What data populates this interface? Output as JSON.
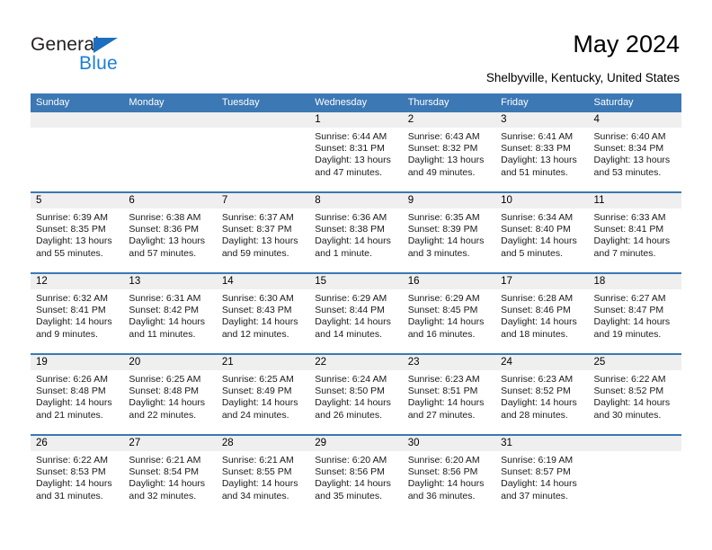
{
  "brand": {
    "name_top": "General",
    "name_bottom": "Blue",
    "triangle_color": "#1c6fc0",
    "blue_color": "#1c7fd6"
  },
  "header": {
    "title": "May 2024",
    "subtitle": "Shelbyville, Kentucky, United States"
  },
  "theme": {
    "header_row_bg": "#3c78b4",
    "day_number_bg": "#efefef",
    "text_color": "#000000"
  },
  "weekdays": [
    "Sunday",
    "Monday",
    "Tuesday",
    "Wednesday",
    "Thursday",
    "Friday",
    "Saturday"
  ],
  "labels": {
    "sunrise": "Sunrise:",
    "sunset": "Sunset:",
    "daylight": "Daylight:"
  },
  "weeks": [
    [
      {
        "day": "",
        "empty": true
      },
      {
        "day": "",
        "empty": true
      },
      {
        "day": "",
        "empty": true
      },
      {
        "day": "1",
        "sunrise": "Sunrise: 6:44 AM",
        "sunset": "Sunset: 8:31 PM",
        "daylight1": "Daylight: 13 hours",
        "daylight2": "and 47 minutes."
      },
      {
        "day": "2",
        "sunrise": "Sunrise: 6:43 AM",
        "sunset": "Sunset: 8:32 PM",
        "daylight1": "Daylight: 13 hours",
        "daylight2": "and 49 minutes."
      },
      {
        "day": "3",
        "sunrise": "Sunrise: 6:41 AM",
        "sunset": "Sunset: 8:33 PM",
        "daylight1": "Daylight: 13 hours",
        "daylight2": "and 51 minutes."
      },
      {
        "day": "4",
        "sunrise": "Sunrise: 6:40 AM",
        "sunset": "Sunset: 8:34 PM",
        "daylight1": "Daylight: 13 hours",
        "daylight2": "and 53 minutes."
      }
    ],
    [
      {
        "day": "5",
        "sunrise": "Sunrise: 6:39 AM",
        "sunset": "Sunset: 8:35 PM",
        "daylight1": "Daylight: 13 hours",
        "daylight2": "and 55 minutes."
      },
      {
        "day": "6",
        "sunrise": "Sunrise: 6:38 AM",
        "sunset": "Sunset: 8:36 PM",
        "daylight1": "Daylight: 13 hours",
        "daylight2": "and 57 minutes."
      },
      {
        "day": "7",
        "sunrise": "Sunrise: 6:37 AM",
        "sunset": "Sunset: 8:37 PM",
        "daylight1": "Daylight: 13 hours",
        "daylight2": "and 59 minutes."
      },
      {
        "day": "8",
        "sunrise": "Sunrise: 6:36 AM",
        "sunset": "Sunset: 8:38 PM",
        "daylight1": "Daylight: 14 hours",
        "daylight2": "and 1 minute."
      },
      {
        "day": "9",
        "sunrise": "Sunrise: 6:35 AM",
        "sunset": "Sunset: 8:39 PM",
        "daylight1": "Daylight: 14 hours",
        "daylight2": "and 3 minutes."
      },
      {
        "day": "10",
        "sunrise": "Sunrise: 6:34 AM",
        "sunset": "Sunset: 8:40 PM",
        "daylight1": "Daylight: 14 hours",
        "daylight2": "and 5 minutes."
      },
      {
        "day": "11",
        "sunrise": "Sunrise: 6:33 AM",
        "sunset": "Sunset: 8:41 PM",
        "daylight1": "Daylight: 14 hours",
        "daylight2": "and 7 minutes."
      }
    ],
    [
      {
        "day": "12",
        "sunrise": "Sunrise: 6:32 AM",
        "sunset": "Sunset: 8:41 PM",
        "daylight1": "Daylight: 14 hours",
        "daylight2": "and 9 minutes."
      },
      {
        "day": "13",
        "sunrise": "Sunrise: 6:31 AM",
        "sunset": "Sunset: 8:42 PM",
        "daylight1": "Daylight: 14 hours",
        "daylight2": "and 11 minutes."
      },
      {
        "day": "14",
        "sunrise": "Sunrise: 6:30 AM",
        "sunset": "Sunset: 8:43 PM",
        "daylight1": "Daylight: 14 hours",
        "daylight2": "and 12 minutes."
      },
      {
        "day": "15",
        "sunrise": "Sunrise: 6:29 AM",
        "sunset": "Sunset: 8:44 PM",
        "daylight1": "Daylight: 14 hours",
        "daylight2": "and 14 minutes."
      },
      {
        "day": "16",
        "sunrise": "Sunrise: 6:29 AM",
        "sunset": "Sunset: 8:45 PM",
        "daylight1": "Daylight: 14 hours",
        "daylight2": "and 16 minutes."
      },
      {
        "day": "17",
        "sunrise": "Sunrise: 6:28 AM",
        "sunset": "Sunset: 8:46 PM",
        "daylight1": "Daylight: 14 hours",
        "daylight2": "and 18 minutes."
      },
      {
        "day": "18",
        "sunrise": "Sunrise: 6:27 AM",
        "sunset": "Sunset: 8:47 PM",
        "daylight1": "Daylight: 14 hours",
        "daylight2": "and 19 minutes."
      }
    ],
    [
      {
        "day": "19",
        "sunrise": "Sunrise: 6:26 AM",
        "sunset": "Sunset: 8:48 PM",
        "daylight1": "Daylight: 14 hours",
        "daylight2": "and 21 minutes."
      },
      {
        "day": "20",
        "sunrise": "Sunrise: 6:25 AM",
        "sunset": "Sunset: 8:48 PM",
        "daylight1": "Daylight: 14 hours",
        "daylight2": "and 22 minutes."
      },
      {
        "day": "21",
        "sunrise": "Sunrise: 6:25 AM",
        "sunset": "Sunset: 8:49 PM",
        "daylight1": "Daylight: 14 hours",
        "daylight2": "and 24 minutes."
      },
      {
        "day": "22",
        "sunrise": "Sunrise: 6:24 AM",
        "sunset": "Sunset: 8:50 PM",
        "daylight1": "Daylight: 14 hours",
        "daylight2": "and 26 minutes."
      },
      {
        "day": "23",
        "sunrise": "Sunrise: 6:23 AM",
        "sunset": "Sunset: 8:51 PM",
        "daylight1": "Daylight: 14 hours",
        "daylight2": "and 27 minutes."
      },
      {
        "day": "24",
        "sunrise": "Sunrise: 6:23 AM",
        "sunset": "Sunset: 8:52 PM",
        "daylight1": "Daylight: 14 hours",
        "daylight2": "and 28 minutes."
      },
      {
        "day": "25",
        "sunrise": "Sunrise: 6:22 AM",
        "sunset": "Sunset: 8:52 PM",
        "daylight1": "Daylight: 14 hours",
        "daylight2": "and 30 minutes."
      }
    ],
    [
      {
        "day": "26",
        "sunrise": "Sunrise: 6:22 AM",
        "sunset": "Sunset: 8:53 PM",
        "daylight1": "Daylight: 14 hours",
        "daylight2": "and 31 minutes."
      },
      {
        "day": "27",
        "sunrise": "Sunrise: 6:21 AM",
        "sunset": "Sunset: 8:54 PM",
        "daylight1": "Daylight: 14 hours",
        "daylight2": "and 32 minutes."
      },
      {
        "day": "28",
        "sunrise": "Sunrise: 6:21 AM",
        "sunset": "Sunset: 8:55 PM",
        "daylight1": "Daylight: 14 hours",
        "daylight2": "and 34 minutes."
      },
      {
        "day": "29",
        "sunrise": "Sunrise: 6:20 AM",
        "sunset": "Sunset: 8:56 PM",
        "daylight1": "Daylight: 14 hours",
        "daylight2": "and 35 minutes."
      },
      {
        "day": "30",
        "sunrise": "Sunrise: 6:20 AM",
        "sunset": "Sunset: 8:56 PM",
        "daylight1": "Daylight: 14 hours",
        "daylight2": "and 36 minutes."
      },
      {
        "day": "31",
        "sunrise": "Sunrise: 6:19 AM",
        "sunset": "Sunset: 8:57 PM",
        "daylight1": "Daylight: 14 hours",
        "daylight2": "and 37 minutes."
      },
      {
        "day": "",
        "empty": true
      }
    ]
  ]
}
